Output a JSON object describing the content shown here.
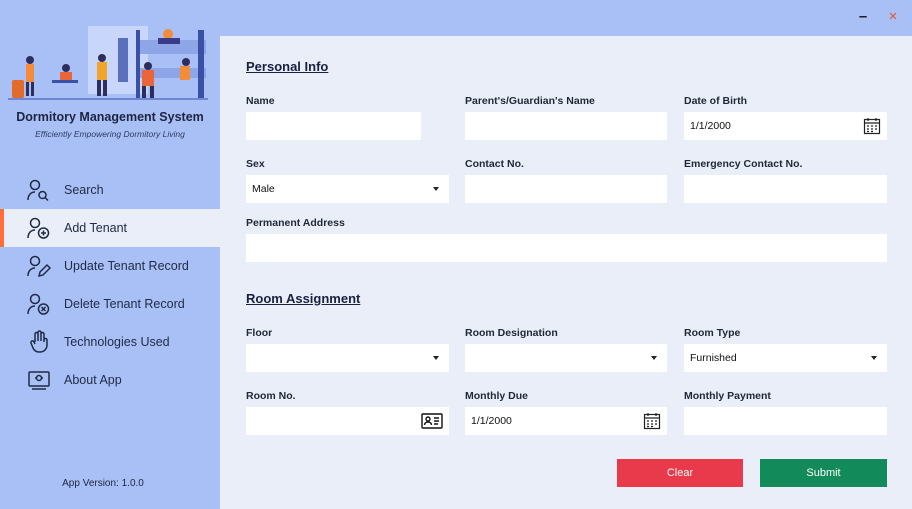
{
  "window": {
    "minimize_glyph": "–",
    "close_glyph": "×"
  },
  "sidebar": {
    "app_title": "Dormitory Management System",
    "tagline": "Efficiently Empowering Dormitory Living",
    "items": [
      {
        "label": "Search",
        "icon": "user-search-icon",
        "active": false
      },
      {
        "label": "Add Tenant",
        "icon": "user-add-icon",
        "active": true
      },
      {
        "label": "Update Tenant Record",
        "icon": "user-edit-icon",
        "active": false
      },
      {
        "label": "Delete Tenant Record",
        "icon": "user-delete-icon",
        "active": false
      },
      {
        "label": "Technologies Used",
        "icon": "hand-icon",
        "active": false
      },
      {
        "label": "About App",
        "icon": "info-card-icon",
        "active": false
      }
    ],
    "version": "App Version: 1.0.0"
  },
  "personal": {
    "title": "Personal Info",
    "name_label": "Name",
    "name_value": "",
    "guardian_label": "Parent's/Guardian's Name",
    "guardian_value": "",
    "dob_label": "Date of Birth",
    "dob_value": "1/1/2000",
    "sex_label": "Sex",
    "sex_value": "Male",
    "contact_label": "Contact No.",
    "contact_value": "",
    "emergency_label": "Emergency Contact No.",
    "emergency_value": "",
    "address_label": "Permanent Address",
    "address_value": ""
  },
  "room": {
    "title": "Room Assignment",
    "floor_label": "Floor",
    "floor_value": "",
    "designation_label": "Room Designation",
    "designation_value": "",
    "type_label": "Room Type",
    "type_value": "Furnished",
    "roomno_label": "Room No.",
    "roomno_value": "",
    "due_label": "Monthly Due",
    "due_value": "1/1/2000",
    "payment_label": "Monthly Payment",
    "payment_value": ""
  },
  "actions": {
    "clear_label": "Clear",
    "submit_label": "Submit"
  },
  "colors": {
    "sidebar": "#a9c0f7",
    "content": "#e9eef8",
    "active_marker": "#ff6f3c",
    "clear": "#e83a4a",
    "submit": "#138a5a"
  }
}
